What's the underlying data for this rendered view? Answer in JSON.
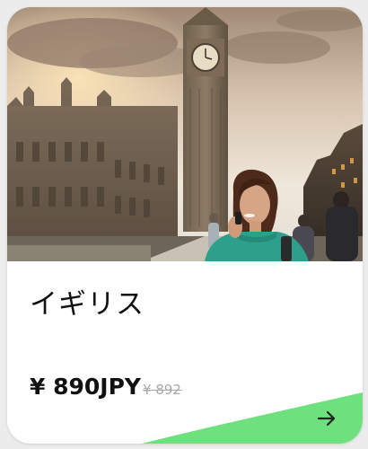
{
  "card": {
    "title": "イギリス",
    "price": "¥ 890JPY",
    "old_price": "¥ 892",
    "accent_color": "#6fe07e",
    "photo_subject": "woman-on-phone-in-front-of-big-ben",
    "action_icon": "arrow-right-icon"
  }
}
